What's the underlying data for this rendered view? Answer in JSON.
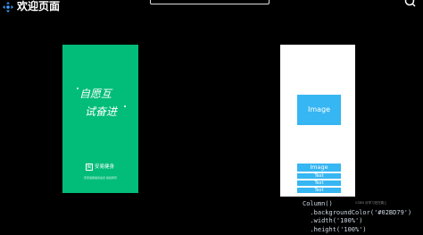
{
  "header": {
    "title": "欢迎页面",
    "icon": "move-handle-icon",
    "top_right_icon": "search-icon"
  },
  "left_preview": {
    "background": "#02BD79",
    "slogan_line1": "自愿互",
    "slogan_line2": "试奋进",
    "brand_mark": "安",
    "brand_name": "安易健身",
    "footer_text": "安安健康健身会员 版权所有"
  },
  "right_preview": {
    "image_big_label": "Image",
    "image_small_label": "Image",
    "text_labels": [
      "Text",
      "Text",
      "Text"
    ],
    "accent": "#36B6F2"
  },
  "code": {
    "lines": [
      "Column()",
      "  .backgroundColor('#02BD79')",
      "  .width('100%')",
      "  .height('100%')"
    ]
  },
  "watermark": "CSDN @学习还在路上"
}
